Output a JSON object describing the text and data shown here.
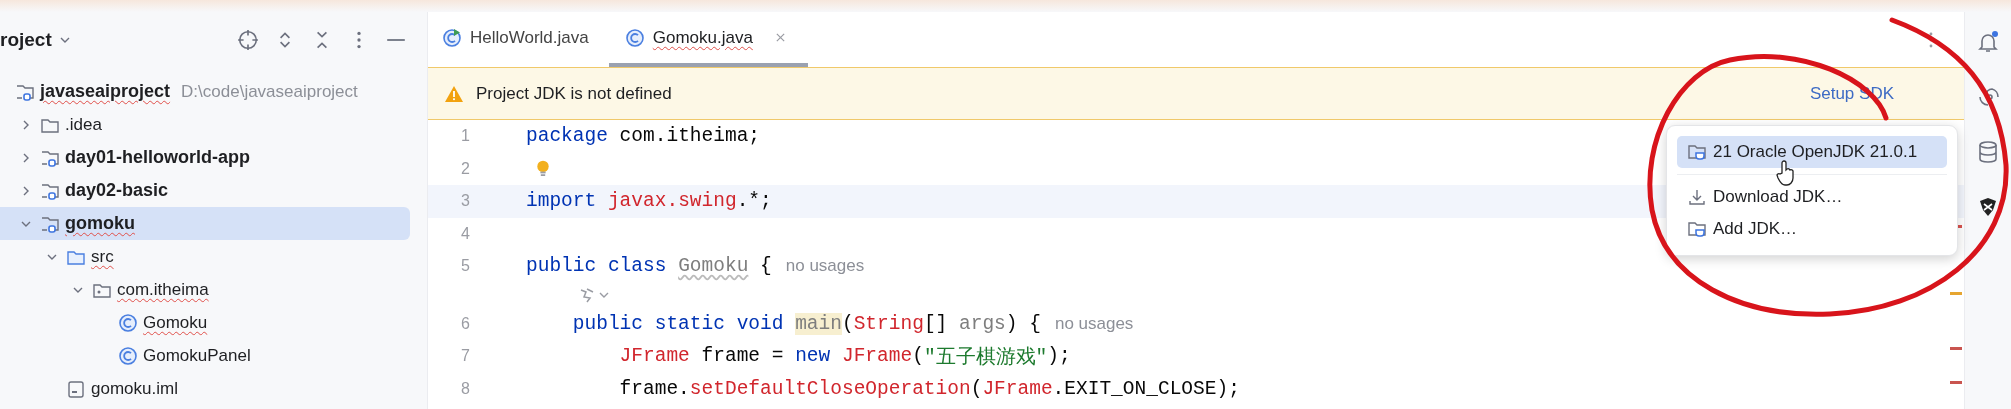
{
  "project_panel": {
    "title": "roject",
    "tree": [
      {
        "name": "javaseaiproject",
        "path": "D:\\code\\javaseaiproject",
        "kind": "module",
        "bold": true,
        "error": true,
        "selected": false,
        "children": [
          {
            "name": ".idea",
            "kind": "folder",
            "bold": false,
            "error": false,
            "selected": false,
            "expanded": false
          },
          {
            "name": "day01-helloworld-app",
            "kind": "module",
            "bold": true,
            "error": false,
            "selected": false,
            "expanded": false
          },
          {
            "name": "day02-basic",
            "kind": "module",
            "bold": true,
            "error": false,
            "selected": false,
            "expanded": false
          },
          {
            "name": "gomoku",
            "kind": "module",
            "bold": true,
            "error": true,
            "selected": true,
            "expanded": true,
            "children": [
              {
                "name": "src",
                "kind": "source",
                "bold": false,
                "error": true,
                "selected": false,
                "expanded": true,
                "children": [
                  {
                    "name": "com.itheima",
                    "kind": "package",
                    "bold": false,
                    "error": true,
                    "selected": false,
                    "expanded": true,
                    "children": [
                      {
                        "name": "Gomoku",
                        "kind": "class",
                        "bold": false,
                        "error": true,
                        "selected": false
                      },
                      {
                        "name": "GomokuPanel",
                        "kind": "class",
                        "bold": false,
                        "error": false,
                        "selected": false
                      }
                    ]
                  }
                ]
              },
              {
                "name": "gomoku.iml",
                "kind": "file",
                "bold": false,
                "error": false,
                "selected": false
              }
            ]
          }
        ]
      }
    ]
  },
  "editor": {
    "tabs": [
      {
        "label": "HelloWorld.java",
        "kind": "runnable",
        "selected": false,
        "error": false,
        "closable": false
      },
      {
        "label": "Gomoku.java",
        "kind": "class",
        "selected": true,
        "error": true,
        "closable": true
      }
    ],
    "banner": {
      "message": "Project JDK is not defined",
      "action": "Setup SDK"
    },
    "lines": [
      {
        "kind": "code",
        "number": "1",
        "current": false,
        "bulb": false,
        "tokens": [
          {
            "kind": "keyword",
            "text": "package"
          },
          {
            "kind": "plain",
            "text": " com.itheima;"
          }
        ]
      },
      {
        "kind": "code",
        "number": "2",
        "current": false,
        "bulb": true
      },
      {
        "kind": "code",
        "number": "3",
        "current": true,
        "bulb": false,
        "tokens": [
          {
            "kind": "keyword",
            "text": "import "
          },
          {
            "kind": "error",
            "text": "javax.swing"
          },
          {
            "kind": "plain",
            "text": ".*;"
          }
        ]
      },
      {
        "kind": "code",
        "number": "4",
        "current": false,
        "bulb": false
      },
      {
        "kind": "code",
        "number": "5",
        "current": false,
        "bulb": false,
        "tokens": [
          {
            "kind": "keyword",
            "text": "public class "
          },
          {
            "kind": "unused",
            "text": "Gomoku"
          },
          {
            "kind": "plain",
            "text": " {"
          },
          {
            "kind": "hint",
            "text": "no usages"
          }
        ]
      },
      {
        "kind": "inlay"
      },
      {
        "kind": "code",
        "number": "6",
        "current": false,
        "bulb": false,
        "tokens": [
          {
            "kind": "keyword",
            "text": "    public static void "
          },
          {
            "kind": "highlight",
            "text": "main"
          },
          {
            "kind": "plain",
            "text": "("
          },
          {
            "kind": "error",
            "text": "String"
          },
          {
            "kind": "plain",
            "text": "[] "
          },
          {
            "kind": "muted",
            "text": "args"
          },
          {
            "kind": "plain",
            "text": ") {"
          },
          {
            "kind": "hint",
            "text": "no usages"
          }
        ]
      },
      {
        "kind": "code",
        "number": "7",
        "current": false,
        "bulb": false,
        "tokens": [
          {
            "kind": "error",
            "text": "        JFrame"
          },
          {
            "kind": "plain",
            "text": " frame = "
          },
          {
            "kind": "keyword",
            "text": "new "
          },
          {
            "kind": "error",
            "text": "JFrame"
          },
          {
            "kind": "plain",
            "text": "("
          },
          {
            "kind": "string",
            "text": "\"五子棋游戏\""
          },
          {
            "kind": "plain",
            "text": ");"
          }
        ]
      },
      {
        "kind": "code",
        "number": "8",
        "current": false,
        "bulb": false,
        "tokens": [
          {
            "kind": "plain",
            "text": "        frame."
          },
          {
            "kind": "error",
            "text": "setDefaultCloseOperation"
          },
          {
            "kind": "plain",
            "text": "("
          },
          {
            "kind": "error",
            "text": "JFrame"
          },
          {
            "kind": "plain",
            "text": ".EXIT_ON_CLOSE);"
          }
        ]
      }
    ]
  },
  "jdk_popup": {
    "items": [
      {
        "kind": "jdk",
        "label": "21 Oracle OpenJDK 21.0.1",
        "selected": true
      },
      {
        "kind": "download",
        "label": "Download JDK…",
        "selected": false
      },
      {
        "kind": "add",
        "label": "Add JDK…",
        "selected": false
      }
    ]
  }
}
